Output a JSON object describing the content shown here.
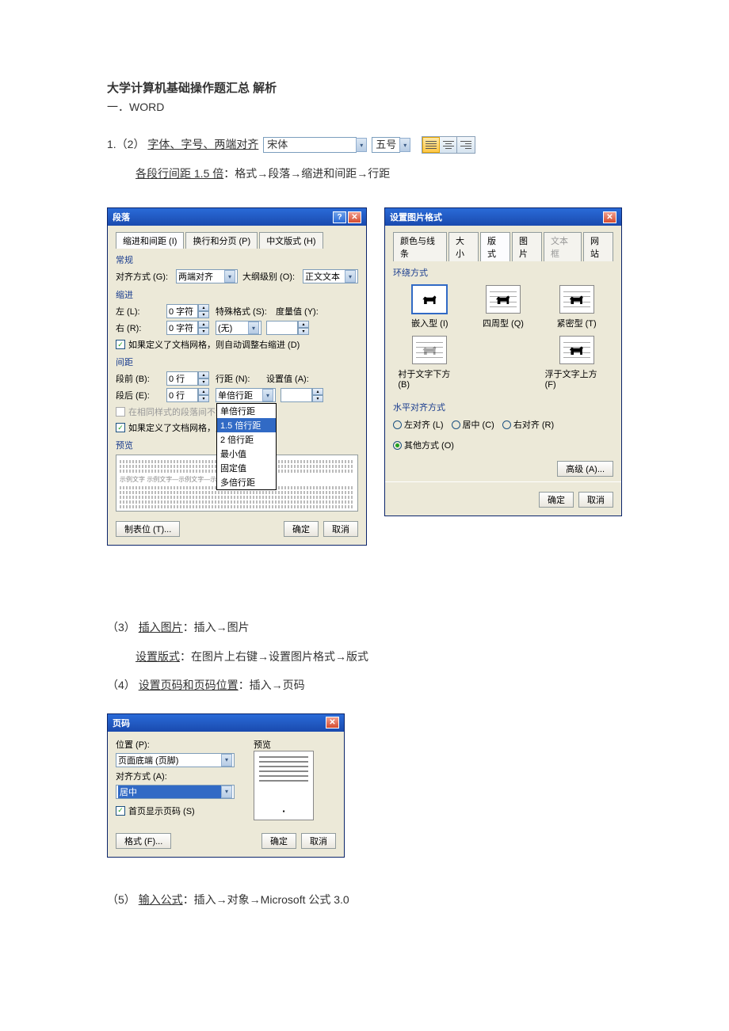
{
  "doc": {
    "title": "大学计算机基础操作题汇总 解析",
    "section1": "一．WORD",
    "item1_prefix": "1.（2）",
    "item1_underline": "字体、字号、两端对齐",
    "toolbar": {
      "font_name": "宋体",
      "font_size": "五号"
    },
    "item1b_u": "各段行间距 1.5 倍",
    "item1b_rest": "：格式→段落→缩进和间距→行距",
    "item3_num": "（3）",
    "item3_u": "插入图片",
    "item3_rest": "：插入→图片",
    "item3b_u": "设置版式",
    "item3b_rest": "：在图片上右键→设置图片格式→版式",
    "item4_num": "（4）",
    "item4_u": "设置页码和页码位置",
    "item4_rest": "：插入→页码",
    "item5_num": "（5）",
    "item5_u": "输入公式",
    "item5_rest": "：插入→对象→Microsoft 公式 3.0"
  },
  "paragraph_dlg": {
    "title": "段落",
    "tabs": [
      "缩进和间距 (I)",
      "换行和分页 (P)",
      "中文版式 (H)"
    ],
    "group_general": "常规",
    "align_label": "对齐方式 (G):",
    "align_value": "两端对齐",
    "outline_label": "大纲级别 (O):",
    "outline_value": "正文文本",
    "group_indent": "缩进",
    "left_label": "左 (L):",
    "left_value": "0 字符",
    "right_label": "右 (R):",
    "right_value": "0 字符",
    "special_label": "特殊格式 (S):",
    "special_value": "(无)",
    "by_label": "度量值 (Y):",
    "chk_grid1": "如果定义了文档网格，则自动调整右缩进 (D)",
    "group_spacing": "间距",
    "before_label": "段前 (B):",
    "before_value": "0 行",
    "after_label": "段后 (E):",
    "after_value": "0 行",
    "linespace_label": "行距 (N):",
    "linespace_value": "单倍行距",
    "setvalue_label": "设置值 (A):",
    "chk_nospace": "在相同样式的段落间不添加空格",
    "chk_grid2": "如果定义了文档网格，则对齐网格",
    "dd_options": [
      "单倍行距",
      "1.5 倍行距",
      "2 倍行距",
      "最小值",
      "固定值",
      "多倍行距"
    ],
    "preview_label": "预览",
    "tabs_btn": "制表位 (T)...",
    "ok": "确定",
    "cancel": "取消"
  },
  "picfmt_dlg": {
    "title": "设置图片格式",
    "tabs": [
      "颜色与线条",
      "大小",
      "版式",
      "图片",
      "文本框",
      "网站"
    ],
    "group_wrap": "环绕方式",
    "w1": "嵌入型 (I)",
    "w2": "四周型 (Q)",
    "w3": "紧密型 (T)",
    "w4": "衬于文字下方 (B)",
    "w5": "浮于文字上方 (F)",
    "group_halign": "水平对齐方式",
    "r1": "左对齐 (L)",
    "r2": "居中 (C)",
    "r3": "右对齐 (R)",
    "r4": "其他方式 (O)",
    "advanced": "高级 (A)...",
    "ok": "确定",
    "cancel": "取消"
  },
  "pgnum_dlg": {
    "title": "页码",
    "pos_label": "位置 (P):",
    "pos_value": "页面底端 (页脚)",
    "align_label": "对齐方式 (A):",
    "align_value": "居中",
    "chk_first": "首页显示页码 (S)",
    "preview_label": "预览",
    "format_btn": "格式 (F)...",
    "ok": "确定",
    "cancel": "取消"
  }
}
